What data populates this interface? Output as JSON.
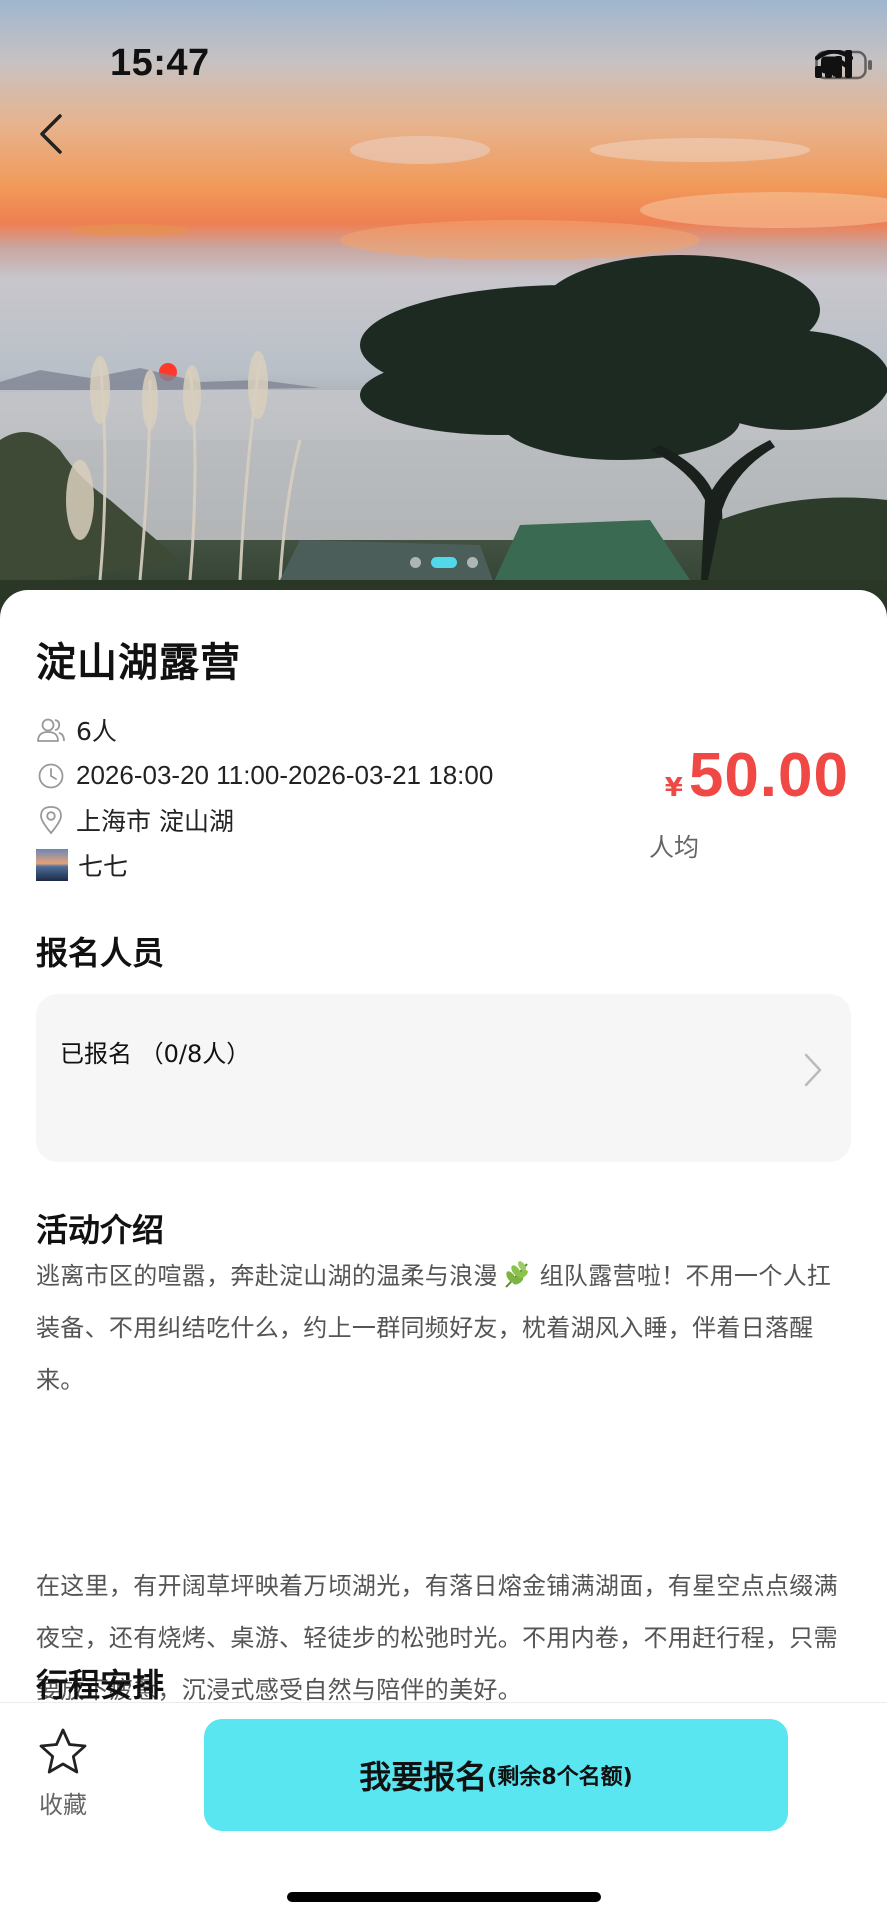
{
  "status_bar": {
    "time": "15:47"
  },
  "hero": {
    "slide_count": 3,
    "active_slide": 2
  },
  "event": {
    "title": "淀山湖露营",
    "people": "6人",
    "time_range": "2026-03-20 11:00-2026-03-21 18:00",
    "location": "上海市 淀山湖",
    "organizer": "七七",
    "price_currency": "¥",
    "price_amount": "50.00",
    "price_unit": "人均"
  },
  "signup": {
    "section_title": "报名人员",
    "registered_text": "已报名 （0/8人）"
  },
  "intro": {
    "section_title": "活动介绍",
    "paragraph_1_before": "逃离市区的喧嚣，奔赴淀山湖的温柔与浪漫",
    "paragraph_1_after": " 组队露营啦！不用一个人扛装备、不用纠结吃什么，约上一群同频好友，枕着湖风入睡，伴着日落醒来。",
    "paragraph_2": "在这里，有开阔草坪映着万顷湖光，有落日熔金铺满湖面，有星空点点缀满夜空，还有烧烤、桌游、轻徒步的松弛时光。不用内卷，不用赶行程，只需要放下疲惫，沉浸式感受自然与陪伴的美好。"
  },
  "schedule": {
    "section_title": "行程安排"
  },
  "bottom_bar": {
    "favorite_label": "收藏",
    "signup_button_main": "我要报名",
    "signup_button_sub": "(剩余8个名额)"
  },
  "colors": {
    "accent": "#5ae6f0",
    "price": "#f04845",
    "indicator_active": "#52d9e9"
  },
  "icons": [
    "back-arrow-icon",
    "signal-icon",
    "wifi-icon",
    "battery-icon",
    "people-icon",
    "clock-icon",
    "location-pin-icon",
    "chevron-right-icon",
    "star-icon",
    "herb-emoji-icon"
  ]
}
